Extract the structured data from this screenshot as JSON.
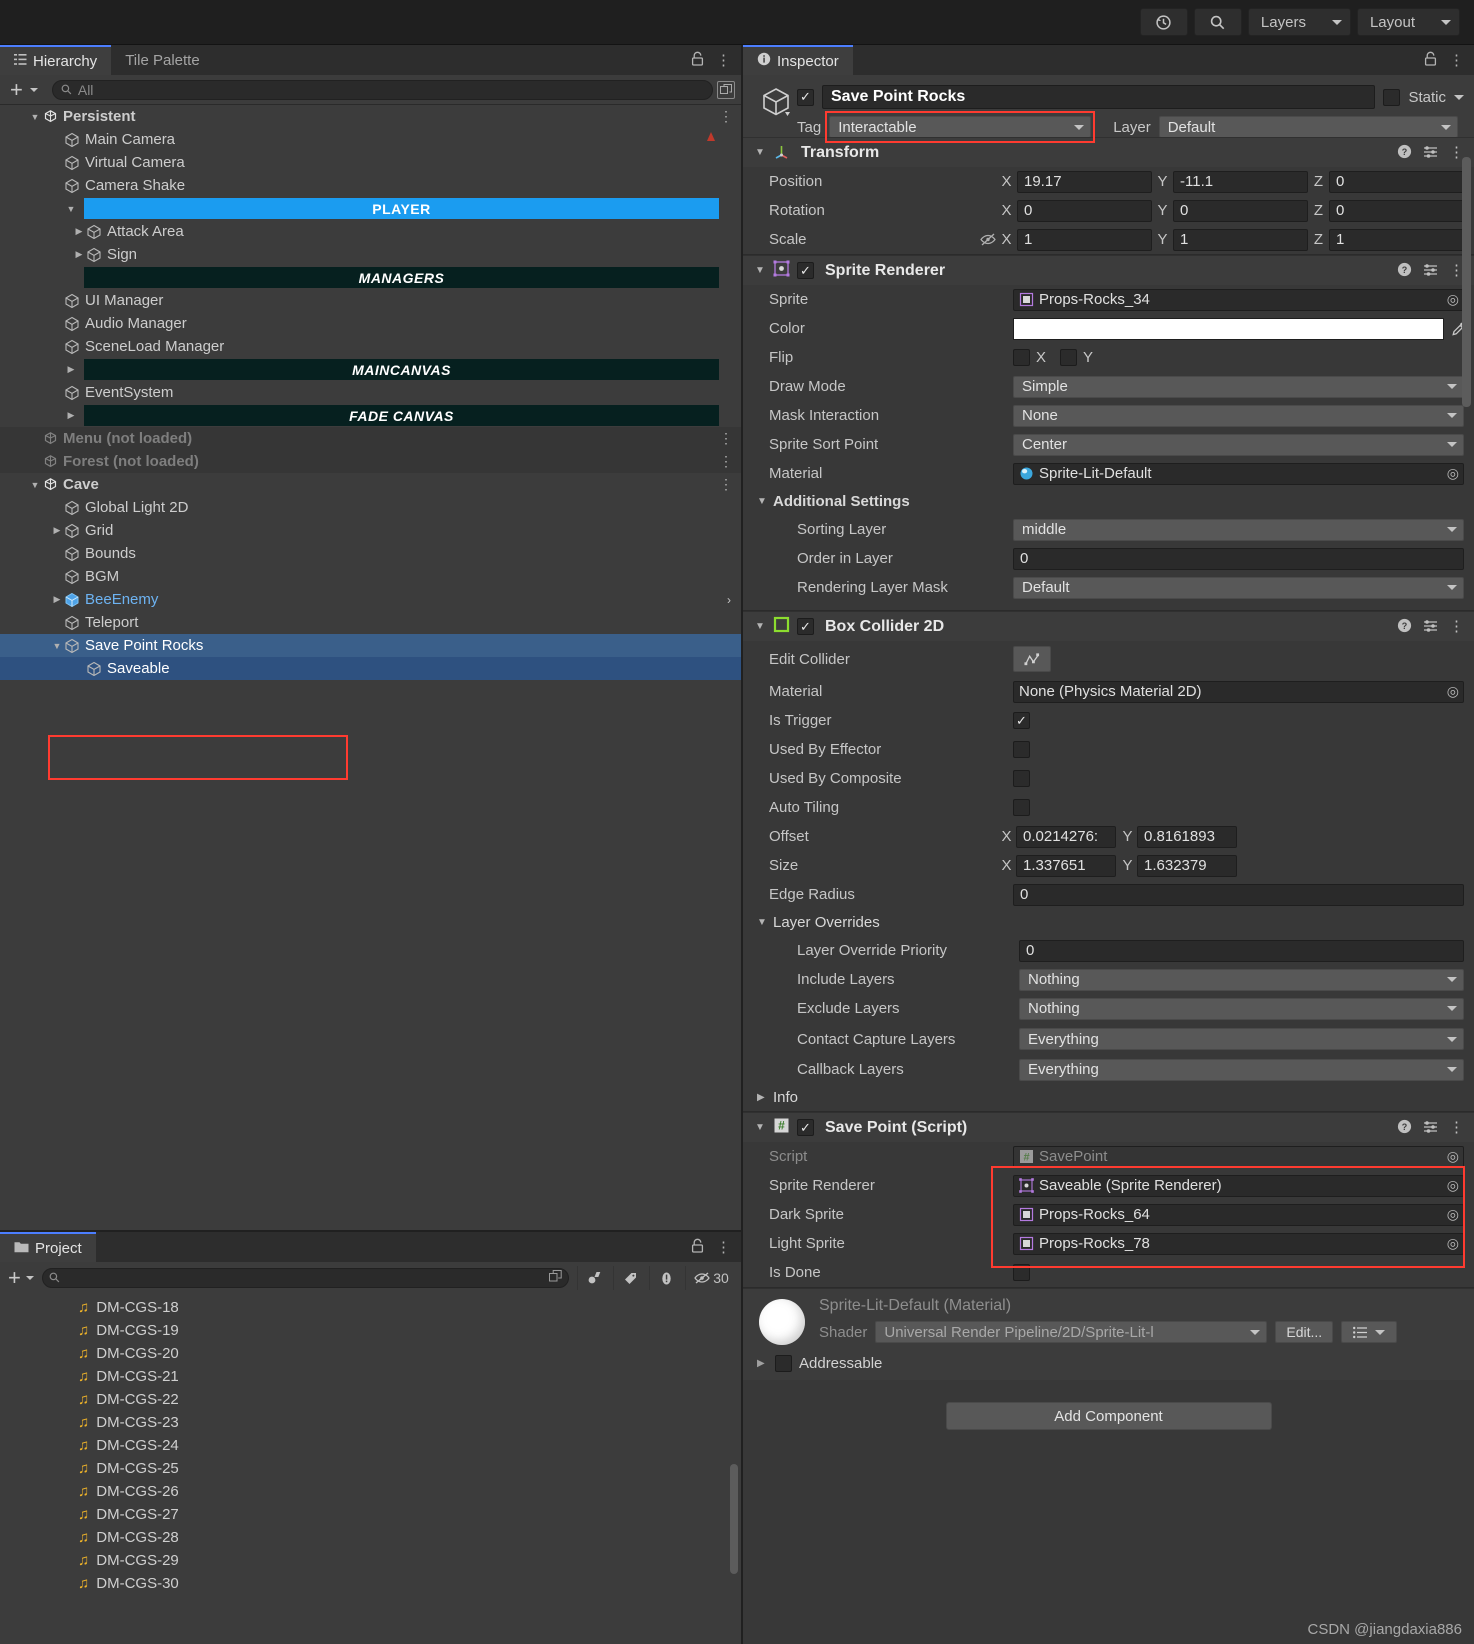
{
  "toolbar": {
    "history_icon": "history-icon",
    "search_icon": "search-icon",
    "layers_label": "Layers",
    "layout_label": "Layout"
  },
  "hierarchy": {
    "tab_label": "Hierarchy",
    "tab2_label": "Tile Palette",
    "search_placeholder": "All",
    "items": [
      {
        "label": "Persistent",
        "indent": 1,
        "icon": "unity-scene-icon",
        "twist": "down",
        "type": "scene",
        "dots": true
      },
      {
        "label": "Main Camera",
        "indent": 2,
        "icon": "gameobject-cube-icon",
        "type": "go",
        "pin": true
      },
      {
        "label": "Virtual Camera",
        "indent": 2,
        "icon": "gameobject-cube-icon",
        "type": "go"
      },
      {
        "label": "Camera Shake",
        "indent": 2,
        "icon": "gameobject-cube-icon",
        "type": "go"
      },
      {
        "label": "PLAYER",
        "indent": 2,
        "type": "sep-player",
        "twist": "down"
      },
      {
        "label": "Attack Area",
        "indent": 3,
        "icon": "gameobject-cube-icon",
        "type": "go",
        "twist": "right"
      },
      {
        "label": "Sign",
        "indent": 3,
        "icon": "gameobject-cube-icon",
        "type": "go",
        "twist": "right"
      },
      {
        "label": "MANAGERS",
        "indent": 2,
        "type": "sep-dark"
      },
      {
        "label": "UI Manager",
        "indent": 2,
        "icon": "gameobject-cube-icon",
        "type": "go"
      },
      {
        "label": "Audio Manager",
        "indent": 2,
        "icon": "gameobject-cube-icon",
        "type": "go"
      },
      {
        "label": "SceneLoad Manager",
        "indent": 2,
        "icon": "gameobject-cube-icon",
        "type": "go"
      },
      {
        "label": "MAINCANVAS",
        "indent": 2,
        "type": "sep-dark",
        "twist": "right"
      },
      {
        "label": "EventSystem",
        "indent": 2,
        "icon": "gameobject-cube-icon",
        "type": "go"
      },
      {
        "label": "FADE CANVAS",
        "indent": 2,
        "type": "sep-dark",
        "twist": "right"
      },
      {
        "label": "Menu (not loaded)",
        "indent": 1,
        "icon": "unity-scene-icon",
        "type": "scene-unloaded",
        "dots": true
      },
      {
        "label": "Forest (not loaded)",
        "indent": 1,
        "icon": "unity-scene-icon",
        "type": "scene-unloaded",
        "dots": true
      },
      {
        "label": "Cave",
        "indent": 1,
        "icon": "unity-scene-icon",
        "type": "scene",
        "twist": "down",
        "dots": true
      },
      {
        "label": "Global Light 2D",
        "indent": 2,
        "icon": "gameobject-cube-icon",
        "type": "go"
      },
      {
        "label": "Grid",
        "indent": 2,
        "icon": "gameobject-cube-icon",
        "type": "go",
        "twist": "right"
      },
      {
        "label": "Bounds",
        "indent": 2,
        "icon": "gameobject-cube-icon",
        "type": "go"
      },
      {
        "label": "BGM",
        "indent": 2,
        "icon": "gameobject-cube-icon",
        "type": "go"
      },
      {
        "label": "BeeEnemy",
        "indent": 2,
        "icon": "prefab-cube-icon",
        "type": "prefab",
        "twist": "right",
        "arrow": true
      },
      {
        "label": "Teleport",
        "indent": 2,
        "icon": "gameobject-cube-icon",
        "type": "go"
      },
      {
        "label": "Save Point Rocks",
        "indent": 2,
        "icon": "gameobject-cube-icon",
        "type": "go",
        "twist": "down",
        "selected": true
      },
      {
        "label": "Saveable",
        "indent": 3,
        "icon": "gameobject-cube-icon",
        "type": "go",
        "selected2": true
      }
    ]
  },
  "project": {
    "tab_label": "Project",
    "search_placeholder": "",
    "hidden_count": "30",
    "toolbar_icons": [
      "save-filter-icon",
      "tag-icon",
      "warning-icon",
      "hidden-eye-icon"
    ],
    "items": [
      {
        "label": "DM-CGS-18",
        "icon": "audio-clip-icon"
      },
      {
        "label": "DM-CGS-19",
        "icon": "audio-clip-icon"
      },
      {
        "label": "DM-CGS-20",
        "icon": "audio-clip-icon"
      },
      {
        "label": "DM-CGS-21",
        "icon": "audio-clip-icon"
      },
      {
        "label": "DM-CGS-22",
        "icon": "audio-clip-icon"
      },
      {
        "label": "DM-CGS-23",
        "icon": "audio-clip-icon"
      },
      {
        "label": "DM-CGS-24",
        "icon": "audio-clip-icon"
      },
      {
        "label": "DM-CGS-25",
        "icon": "audio-clip-icon"
      },
      {
        "label": "DM-CGS-26",
        "icon": "audio-clip-icon"
      },
      {
        "label": "DM-CGS-27",
        "icon": "audio-clip-icon"
      },
      {
        "label": "DM-CGS-28",
        "icon": "audio-clip-icon"
      },
      {
        "label": "DM-CGS-29",
        "icon": "audio-clip-icon"
      },
      {
        "label": "DM-CGS-30",
        "icon": "audio-clip-icon"
      }
    ]
  },
  "inspector": {
    "tab_label": "Inspector",
    "object_name": "Save Point Rocks",
    "object_enabled": true,
    "static_label": "Static",
    "tag_label": "Tag",
    "tag_value": "Interactable",
    "layer_label": "Layer",
    "layer_value": "Default",
    "transform": {
      "title": "Transform",
      "position_label": "Position",
      "position": {
        "x": "19.17",
        "y": "-11.1",
        "z": "0"
      },
      "rotation_label": "Rotation",
      "rotation": {
        "x": "0",
        "y": "0",
        "z": "0"
      },
      "scale_label": "Scale",
      "scale": {
        "x": "1",
        "y": "1",
        "z": "1"
      },
      "axis_x": "X",
      "axis_y": "Y",
      "axis_z": "Z"
    },
    "sprite_renderer": {
      "title": "Sprite Renderer",
      "enabled": true,
      "sprite_label": "Sprite",
      "sprite_value": "Props-Rocks_34",
      "color_label": "Color",
      "color_value": "#ffffff",
      "flip_label": "Flip",
      "flip_x_label": "X",
      "flip_y_label": "Y",
      "draw_mode_label": "Draw Mode",
      "draw_mode_value": "Simple",
      "mask_interaction_label": "Mask Interaction",
      "mask_interaction_value": "None",
      "sprite_sort_point_label": "Sprite Sort Point",
      "sprite_sort_point_value": "Center",
      "material_label": "Material",
      "material_value": "Sprite-Lit-Default",
      "additional_settings_label": "Additional Settings",
      "sorting_layer_label": "Sorting Layer",
      "sorting_layer_value": "middle",
      "order_in_layer_label": "Order in Layer",
      "order_in_layer_value": "0",
      "rendering_layer_mask_label": "Rendering Layer Mask",
      "rendering_layer_mask_value": "Default"
    },
    "box_collider": {
      "title": "Box Collider 2D",
      "enabled": true,
      "edit_collider_label": "Edit Collider",
      "material_label": "Material",
      "material_value": "None (Physics Material 2D)",
      "is_trigger_label": "Is Trigger",
      "is_trigger_checked": true,
      "used_by_effector_label": "Used By Effector",
      "used_by_composite_label": "Used By Composite",
      "auto_tiling_label": "Auto Tiling",
      "offset_label": "Offset",
      "offset": {
        "x": "0.0214276:",
        "y": "0.8161893"
      },
      "size_label": "Size",
      "size": {
        "x": "1.337651",
        "y": "1.632379"
      },
      "edge_radius_label": "Edge Radius",
      "edge_radius_value": "0",
      "layer_overrides_label": "Layer Overrides",
      "layer_override_priority_label": "Layer Override Priority",
      "layer_override_priority_value": "0",
      "include_layers_label": "Include Layers",
      "include_layers_value": "Nothing",
      "exclude_layers_label": "Exclude Layers",
      "exclude_layers_value": "Nothing",
      "contact_capture_layers_label": "Contact Capture Layers",
      "contact_capture_layers_value": "Everything",
      "callback_layers_label": "Callback Layers",
      "callback_layers_value": "Everything",
      "info_label": "Info",
      "axis_x": "X",
      "axis_y": "Y"
    },
    "save_point_script": {
      "title": "Save Point (Script)",
      "enabled": true,
      "script_label": "Script",
      "script_value": "SavePoint",
      "sprite_renderer_label": "Sprite Renderer",
      "sprite_renderer_value": "Saveable (Sprite Renderer)",
      "dark_sprite_label": "Dark Sprite",
      "dark_sprite_value": "Props-Rocks_64",
      "light_sprite_label": "Light Sprite",
      "light_sprite_value": "Props-Rocks_78",
      "is_done_label": "Is Done",
      "is_done_checked": false
    },
    "material_preview": {
      "name": "Sprite-Lit-Default (Material)",
      "shader_label": "Shader",
      "shader_value": "Universal Render Pipeline/2D/Sprite-Lit-l",
      "edit_label": "Edit...",
      "addressable_label": "Addressable",
      "addressable_checked": false
    },
    "add_component_label": "Add Component"
  },
  "watermark": "CSDN @jiangdaxia886",
  "colors": {
    "accent_blue": "#1b9cf0",
    "selection_blue": "#3a5f8a",
    "highlight_red": "#ff3b30",
    "separator_dark": "#06201f",
    "audio_yellow": "#f0b429"
  }
}
